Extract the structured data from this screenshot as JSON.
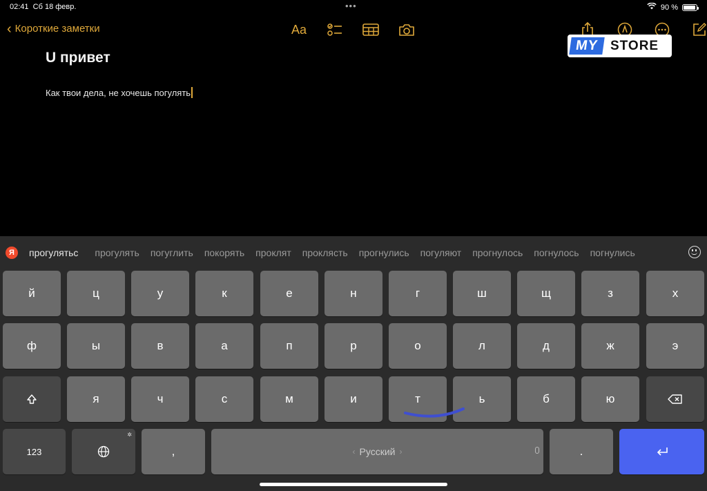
{
  "status": {
    "time": "02:41",
    "date": "Сб 18 февр.",
    "dots": "•••",
    "battery": "90 %"
  },
  "toolbar": {
    "back_label": "Короткие заметки",
    "format_label": "Aa"
  },
  "logo": {
    "my": "MY",
    "store": "STORE"
  },
  "note": {
    "title": "U привет",
    "body": "Как твои дела, не хочешь погулять"
  },
  "suggestions": {
    "badge": "Я",
    "items": [
      "прогулятьс",
      "прогулять",
      "погуглить",
      "покорять",
      "проклят",
      "проклясть",
      "прогнулись",
      "погуляют",
      "прогнулось",
      "погнулось",
      "погнулись"
    ]
  },
  "keys": {
    "row1": [
      "й",
      "ц",
      "у",
      "к",
      "е",
      "н",
      "г",
      "ш",
      "щ",
      "з",
      "х"
    ],
    "row2": [
      "ф",
      "ы",
      "в",
      "а",
      "п",
      "р",
      "о",
      "л",
      "д",
      "ж",
      "э"
    ],
    "row3": [
      "я",
      "ч",
      "с",
      "м",
      "и",
      "т",
      "ь",
      "б",
      "ю"
    ],
    "numbers": "123",
    "comma": ",",
    "space": "Русский",
    "period": ".",
    "space_left": "‹",
    "space_right": "›"
  },
  "colors": {
    "accent": "#e0a93a",
    "key": "#6b6b6b",
    "key_dark": "#474747",
    "return_key": "#4a63f0",
    "keyboard_bg": "#2b2b2b"
  }
}
